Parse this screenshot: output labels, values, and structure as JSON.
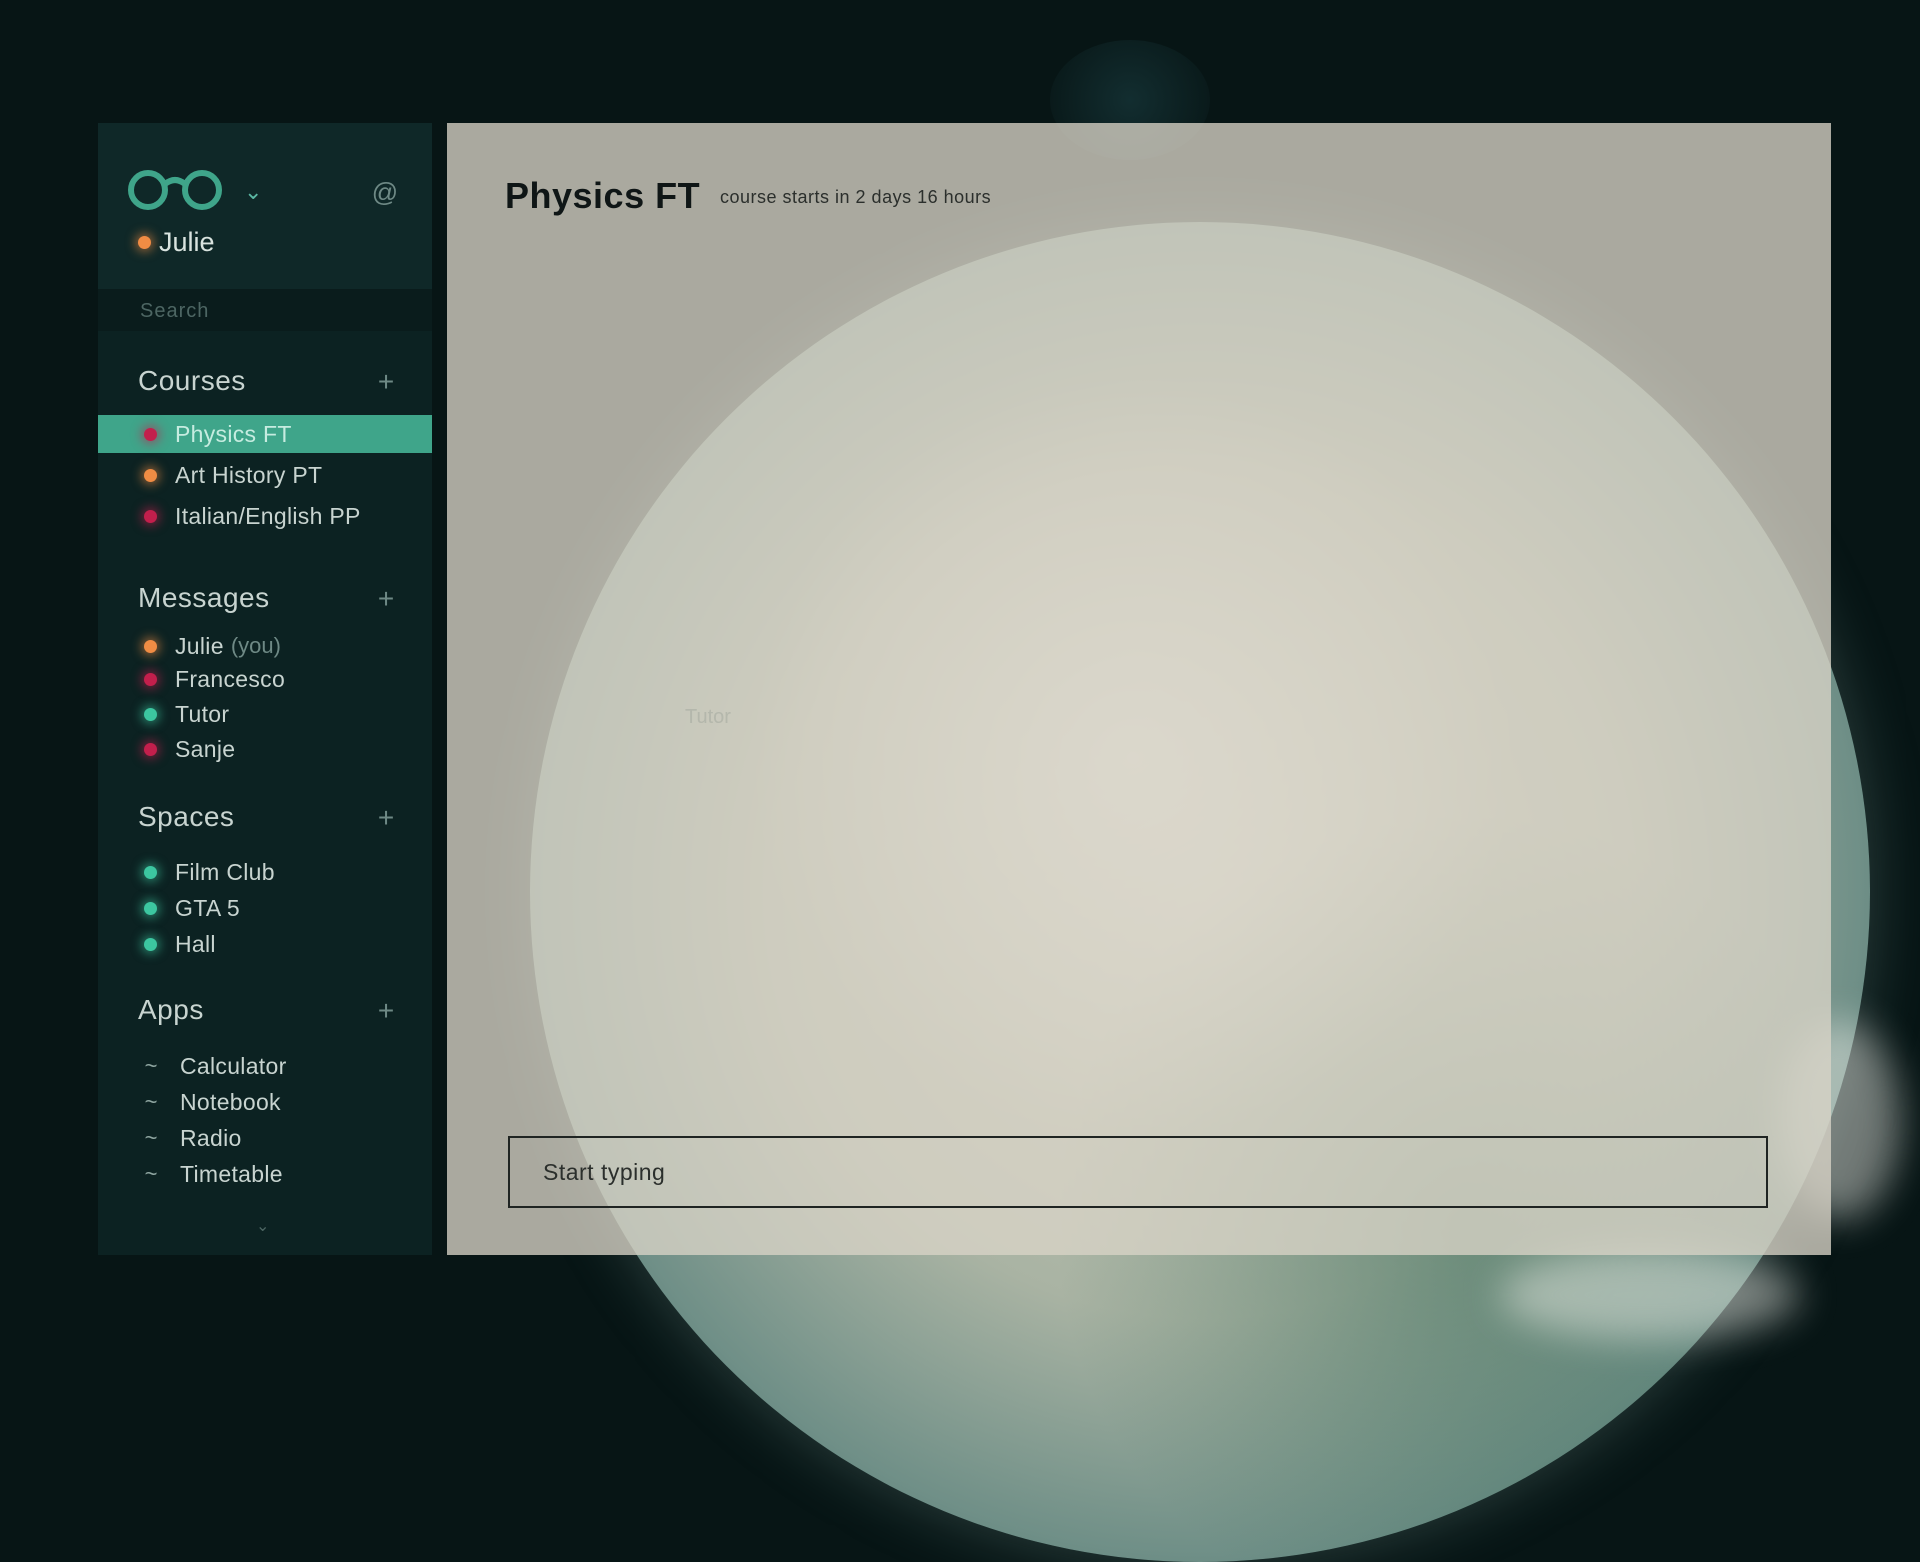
{
  "app": {
    "user": {
      "name": "Julie",
      "status_color": "#f08c44"
    },
    "search": {
      "placeholder": "Search"
    }
  },
  "sidebar": {
    "courses": {
      "title": "Courses",
      "items": [
        {
          "label": "Physics FT",
          "status": "red",
          "active": true
        },
        {
          "label": "Art History PT",
          "status": "orange",
          "active": false
        },
        {
          "label": "Italian/English PP",
          "status": "red",
          "active": false
        }
      ]
    },
    "messages": {
      "title": "Messages",
      "items": [
        {
          "label": "Julie",
          "suffix": "(you)",
          "status": "orange"
        },
        {
          "label": "Francesco",
          "status": "red"
        },
        {
          "label": "Tutor",
          "status": "teal"
        },
        {
          "label": "Sanje",
          "status": "red"
        }
      ]
    },
    "spaces": {
      "title": "Spaces",
      "items": [
        {
          "label": "Film Club",
          "status": "teal"
        },
        {
          "label": "GTA 5",
          "status": "teal"
        },
        {
          "label": "Hall",
          "status": "teal"
        }
      ]
    },
    "apps": {
      "title": "Apps",
      "items": [
        {
          "label": "Calculator",
          "icon": "tilde-icon"
        },
        {
          "label": "Notebook",
          "icon": "tilde-icon"
        },
        {
          "label": "Radio",
          "icon": "tilde-icon"
        },
        {
          "label": "Timetable",
          "icon": "tilde-icon"
        }
      ]
    }
  },
  "main": {
    "title": "Physics FT",
    "subtitle": "course starts in 2 days 16 hours",
    "ghost_text": "Tutor",
    "composer": {
      "placeholder": "Start typing"
    }
  },
  "colors": {
    "accent": "#3fa58a",
    "orange": "#f08c44",
    "red": "#c21f4c",
    "teal": "#3cc6a0",
    "sidebar_bg": "#0c2222"
  }
}
